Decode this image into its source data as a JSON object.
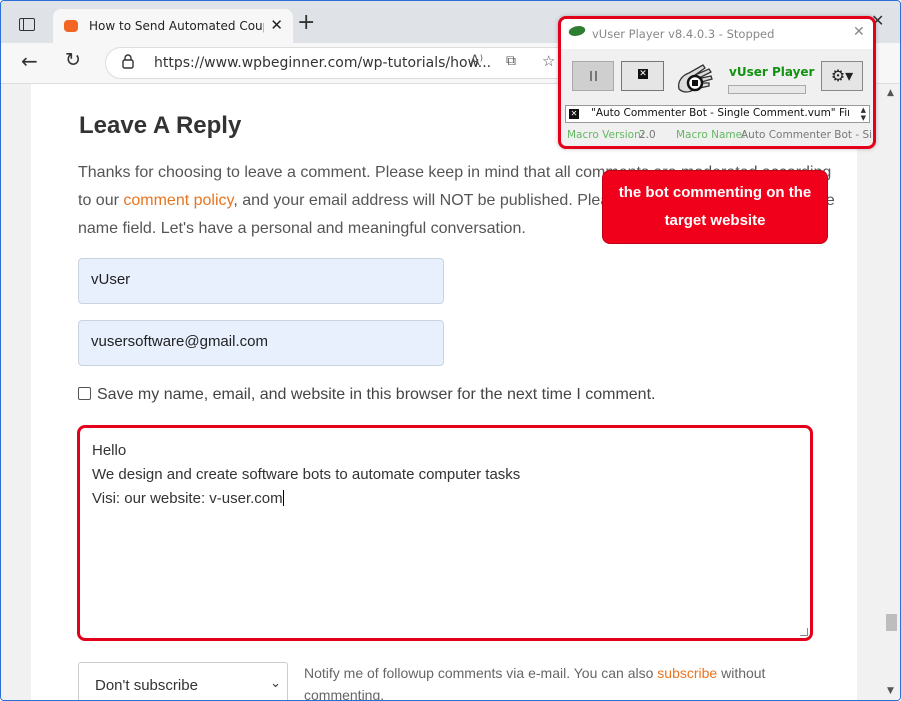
{
  "browser": {
    "tab_title": "How to Send Automated Coupon",
    "tab_close": "✕",
    "new_tab": "+",
    "window_close": "✕",
    "url": "https://www.wpbeginner.com/wp-tutorials/how...",
    "back": "←",
    "reload": "↻",
    "read_aloud": "A⁾",
    "reader": "⧉",
    "favorite": "☆"
  },
  "page": {
    "heading": "Leave A Reply",
    "intro_before_link": "Thanks for choosing to leave a comment. Please keep in mind that all comments are moderated according to our ",
    "intro_link": "comment policy",
    "intro_after_link": ", and your email address will NOT be published. Please Do NOT use keywords in the name field. Let's have a personal and meaningful conversation.",
    "name_value": "vUser",
    "email_value": "vusersoftware@gmail.com",
    "save_label": "Save my name, email, and website in this browser for the next time I comment.",
    "comment_lines": [
      "Hello",
      "We design and create software bots to automate computer tasks",
      "Visi: our website: v-user.com"
    ],
    "subscribe_select": "Don't subscribe",
    "notify_before_link": "Notify me of followup comments via e-mail. You can also ",
    "notify_link": "subscribe",
    "notify_after_link": " without commenting."
  },
  "player": {
    "title": "vUser Player v8.4.0.3 - Stopped",
    "brand": "vUser Player",
    "macro_file": "\"Auto Commenter Bot - Single Comment.vum\" Finis...",
    "macro_version_label": "Macro Version:",
    "macro_version": "2.0",
    "macro_name_label": "Macro Name:",
    "macro_name": "Auto Commenter Bot - Singl",
    "close": "✕",
    "gear": "⚙▾",
    "stop_glyph": "✕"
  },
  "callout": {
    "line1": "the bot commenting on the",
    "line2": "target website"
  },
  "colors": {
    "accent_link": "#e8741f",
    "highlight_red": "#e3001b",
    "field_bg": "#e8f0fe",
    "brand_green": "#129211"
  }
}
